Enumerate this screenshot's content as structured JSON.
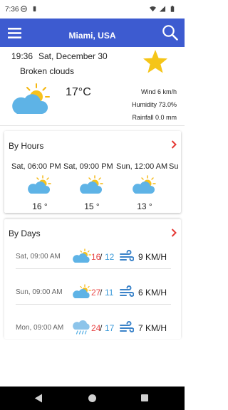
{
  "status_bar": {
    "time": "7:36",
    "icons": [
      "at-sign-icon",
      "battery-saver-icon",
      "wifi-icon",
      "cell-signal-icon",
      "battery-icon"
    ]
  },
  "app_bar": {
    "title": "Miami, USA",
    "menu_icon": "menu-icon",
    "search_icon": "search-icon"
  },
  "current": {
    "time": "19:36",
    "date": "Sat, December 30",
    "condition": "Broken clouds",
    "temperature": "17°C",
    "wind": "Wind 6 km/h",
    "humidity": "Humidity 73.0%",
    "rainfall": "Rainfall 0.0 mm",
    "favorite_icon": "star-icon",
    "weather_icon": "partly-cloudy-icon"
  },
  "hours": {
    "title": "By Hours",
    "items": [
      {
        "label": "Sat, 06:00 PM",
        "temp": "16 °",
        "icon": "partly-cloudy-icon"
      },
      {
        "label": "Sat, 09:00 PM",
        "temp": "15 °",
        "icon": "partly-cloudy-icon"
      },
      {
        "label": "Sun, 12:00 AM",
        "temp": "13 °",
        "icon": "partly-cloudy-icon"
      },
      {
        "label": "Su",
        "temp": "",
        "icon": ""
      }
    ]
  },
  "days": {
    "title": "By Days",
    "items": [
      {
        "label": "Sat, 09:00 AM",
        "hi": "16",
        "sep": "/",
        "lo": "12",
        "wind": "9 KM/H",
        "icon": "partly-cloudy-icon"
      },
      {
        "label": "Sun, 09:00 AM",
        "hi": "27",
        "sep": "/",
        "lo": "11",
        "wind": "6 KM/H",
        "icon": "partly-cloudy-icon"
      },
      {
        "label": "Mon, 09:00 AM",
        "hi": "24",
        "sep": "/",
        "lo": "17",
        "wind": "7 KM/H",
        "icon": "rain-cloud-icon"
      }
    ]
  },
  "colors": {
    "accent": "#3d5bd0",
    "high_temp": "#e84a4a",
    "low_temp": "#3b9ad9",
    "star": "#f5c518",
    "chevron": "#e53935"
  }
}
